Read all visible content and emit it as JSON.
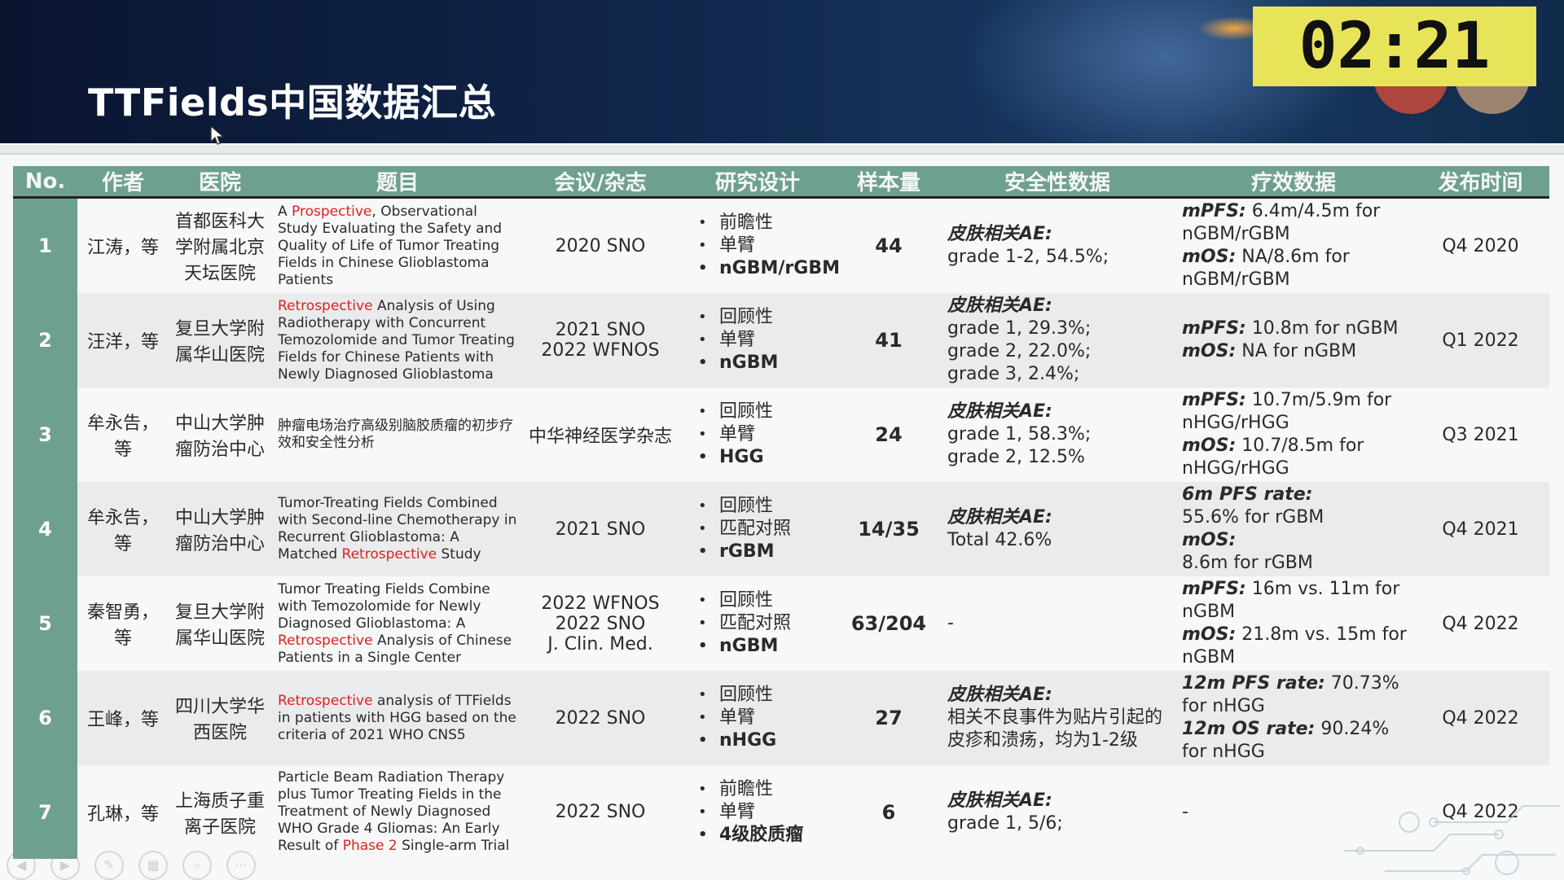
{
  "slide": {
    "title": "TTFields中国数据汇总",
    "timer": "02:21"
  },
  "headers": [
    "No.",
    "作者",
    "医院",
    "题目",
    "会议/杂志",
    "研究设计",
    "样本量",
    "安全性数据",
    "疗效数据",
    "发布时间"
  ],
  "rows": [
    {
      "no": "1",
      "author": "江涛，等",
      "hospital": "首都医科大学附属北京天坛医院",
      "title_parts": [
        "A ",
        "Prospective",
        ", Observational Study Evaluating the Safety and Quality of Life of Tumor Treating Fields in Chinese Glioblastoma Patients"
      ],
      "venue": "2020 SNO",
      "design": [
        "前瞻性",
        "单臂",
        "nGBM/rGBM"
      ],
      "sample": "44",
      "safety_label": "皮肤相关AE:",
      "safety_text": "grade 1-2, 54.5%;",
      "efficacy": [
        {
          "label": "mPFS:",
          "text": " 6.4m/4.5m for nGBM/rGBM"
        },
        {
          "label": "mOS:",
          "text": " NA/8.6m for nGBM/rGBM"
        }
      ],
      "date": "Q4 2020"
    },
    {
      "no": "2",
      "author": "汪洋，等",
      "hospital": "复旦大学附属华山医院",
      "title_parts": [
        "",
        "Retrospective",
        " Analysis of Using Radiotherapy with Concurrent Temozolomide and Tumor Treating Fields for Chinese Patients with Newly Diagnosed Glioblastoma"
      ],
      "venue": "2021 SNO\n2022 WFNOS",
      "design": [
        "回顾性",
        "单臂",
        "nGBM"
      ],
      "sample": "41",
      "safety_label": "皮肤相关AE:",
      "safety_text": "grade 1, 29.3%;\ngrade 2, 22.0%;\ngrade 3, 2.4%;",
      "efficacy": [
        {
          "label": "mPFS:",
          "text": " 10.8m for nGBM"
        },
        {
          "label": "mOS:",
          "text": " NA for nGBM"
        }
      ],
      "date": "Q1 2022"
    },
    {
      "no": "3",
      "author": "牟永告，等",
      "hospital": "中山大学肿瘤防治中心",
      "title_parts": [
        "肿瘤电场治疗高级别脑胶质瘤的初步疗效和安全性分析",
        "",
        ""
      ],
      "venue": "中华神经医学杂志",
      "design": [
        "回顾性",
        "单臂",
        "HGG"
      ],
      "sample": "24",
      "safety_label": "皮肤相关AE:",
      "safety_text": "grade 1, 58.3%;\ngrade 2, 12.5%",
      "efficacy": [
        {
          "label": "mPFS:",
          "text": " 10.7m/5.9m for nHGG/rHGG"
        },
        {
          "label": "mOS:",
          "text": " 10.7/8.5m for nHGG/rHGG"
        }
      ],
      "date": "Q3 2021"
    },
    {
      "no": "4",
      "author": "牟永告，等",
      "hospital": "中山大学肿瘤防治中心",
      "title_parts": [
        "Tumor-Treating Fields Combined with Second-line Chemotherapy in Recurrent Glioblastoma: A Matched ",
        "Retrospective",
        " Study"
      ],
      "venue": "2021 SNO",
      "design": [
        "回顾性",
        "匹配对照",
        "rGBM"
      ],
      "sample": "14/35",
      "safety_label": "皮肤相关AE:",
      "safety_text": "Total 42.6%",
      "efficacy": [
        {
          "label": "6m PFS rate:",
          "text": "\n55.6% for rGBM"
        },
        {
          "label": "mOS:",
          "text": "\n8.6m for rGBM"
        }
      ],
      "date": "Q4 2021"
    },
    {
      "no": "5",
      "author": "秦智勇，等",
      "hospital": "复旦大学附属华山医院",
      "title_parts": [
        "Tumor Treating Fields Combine with Temozolomide for Newly Diagnosed Glioblastoma: A ",
        "Retrospective",
        " Analysis of Chinese Patients in a Single Center"
      ],
      "venue": "2022 WFNOS\n2022 SNO\nJ. Clin. Med.",
      "design": [
        "回顾性",
        "匹配对照",
        "nGBM"
      ],
      "sample": "63/204",
      "safety_label": "",
      "safety_text": "-",
      "efficacy": [
        {
          "label": "mPFS:",
          "text": " 16m vs. 11m for nGBM"
        },
        {
          "label": "mOS:",
          "text": " 21.8m vs. 15m for nGBM"
        }
      ],
      "date": "Q4 2022"
    },
    {
      "no": "6",
      "author": "王峰，等",
      "hospital": "四川大学华西医院",
      "title_parts": [
        "",
        "Retrospective",
        " analysis of TTFields in patients with HGG based on the criteria of 2021 WHO CNS5"
      ],
      "venue": "2022 SNO",
      "design": [
        "回顾性",
        "单臂",
        "nHGG"
      ],
      "sample": "27",
      "safety_label": "皮肤相关AE:",
      "safety_text": "相关不良事件为贴片引起的皮疹和溃疡，均为1-2级",
      "efficacy": [
        {
          "label": "12m PFS rate:",
          "text": " 70.73% for nHGG"
        },
        {
          "label": "12m OS rate:",
          "text": " 90.24% for nHGG"
        }
      ],
      "date": "Q4 2022"
    },
    {
      "no": "7",
      "author": "孔琳，等",
      "hospital": "上海质子重离子医院",
      "title_parts": [
        "Particle Beam Radiation Therapy plus Tumor Treating Fields in the Treatment of Newly Diagnosed WHO Grade 4 Gliomas: An Early Result of ",
        "Phase 2",
        " Single-arm Trial"
      ],
      "venue": "2022 SNO",
      "design": [
        "前瞻性",
        "单臂",
        "4级胶质瘤"
      ],
      "sample": "6",
      "safety_label": "皮肤相关AE:",
      "safety_text": "grade 1, 5/6;",
      "efficacy": [
        {
          "label": "",
          "text": "-"
        }
      ],
      "date": "Q4 2022"
    }
  ],
  "colors": {
    "header_green": "#6ea08e",
    "highlight_red": "#e02020",
    "timer_bg": "#e8e45a",
    "banner_dark": "#0a1530"
  },
  "icons": [
    "mouse-cursor-icon",
    "prev-icon",
    "next-icon",
    "pen-icon",
    "grid-icon",
    "zoom-icon",
    "more-icon"
  ]
}
